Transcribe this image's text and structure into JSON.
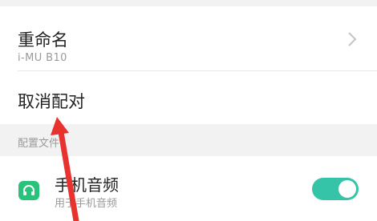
{
  "rename": {
    "title": "重命名",
    "value": "i-MU B10"
  },
  "unpair": {
    "label": "取消配对"
  },
  "section": {
    "label": "配置文件"
  },
  "phone_audio": {
    "title": "手机音频",
    "subtitle": "用于手机音频",
    "enabled": true
  },
  "colors": {
    "toggle_on": "#35c4a8",
    "app_icon": "#29c27a",
    "annotation_arrow": "#e8322e",
    "section_background": "#f2f2f2"
  },
  "icons": {
    "rename_chevron": "chevron-right-icon",
    "phone_audio": "headset-icon"
  }
}
